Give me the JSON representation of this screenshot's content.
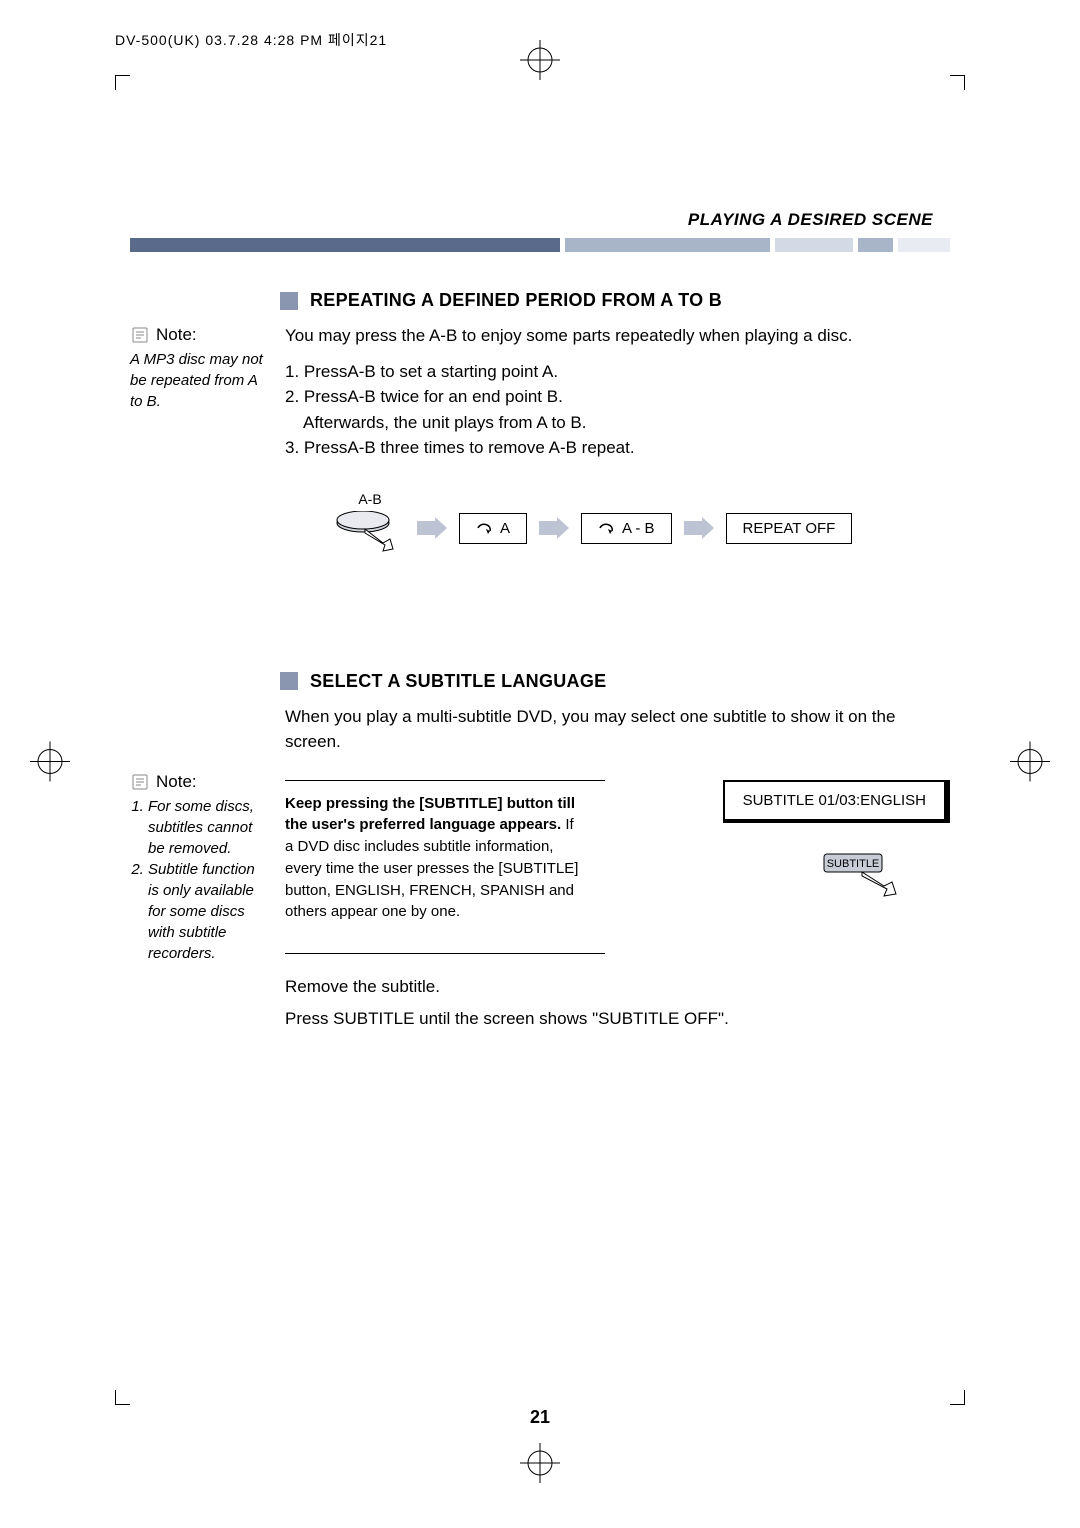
{
  "header": {
    "stamp": "DV-500(UK)  03.7.28 4:28 PM  페이지21"
  },
  "page": {
    "sectionHeader": "PLAYING A DESIRED SCENE",
    "number": "21"
  },
  "section1": {
    "heading": "REPEATING A DEFINED PERIOD FROM A TO B",
    "noteLabel": "Note:",
    "noteBody": "A MP3 disc may not be repeated from A to B.",
    "intro": "You may press the A-B to enjoy some parts repeatedly when playing a disc.",
    "step1": "1. PressA-B  to set a starting point A.",
    "step2": "2. PressA-B  twice for an end point B.",
    "step2b": "Afterwards, the unit plays from A to B.",
    "step3": "3. PressA-B  three times to remove A-B repeat.",
    "btnLabel": "A-B",
    "osd1": "A",
    "osd2": "A - B",
    "osd3": "REPEAT OFF"
  },
  "section2": {
    "heading": "SELECT A SUBTITLE LANGUAGE",
    "intro": "When you play a multi-subtitle DVD, you may select one subtitle to show it on the screen.",
    "noteLabel": "Note:",
    "note1": "For some discs, subtitles cannot be removed.",
    "note2": "Subtitle function is only available for some discs with subtitle recorders.",
    "bold1": "Keep pressing the [SUBTITLE] button till the user's preferred language appears.",
    "body1": "If a DVD disc includes subtitle information, every time the user presses the [SUBTITLE] button, ENGLISH, FRENCH, SPANISH and others appear one by one.",
    "osd": "SUBTITLE 01/03:ENGLISH",
    "btnLabel": "SUBTITLE",
    "remove1": "Remove the subtitle.",
    "remove2": "Press SUBTITLE until the screen shows \"SUBTITLE OFF\"."
  }
}
